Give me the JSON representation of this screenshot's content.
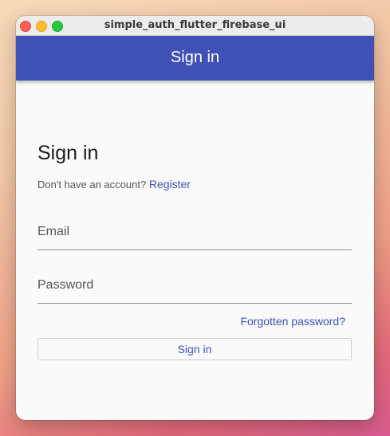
{
  "window": {
    "title": "simple_auth_flutter_firebase_ui"
  },
  "appbar": {
    "title": "Sign in"
  },
  "form": {
    "heading": "Sign in",
    "register_prompt": "Don't have an account?",
    "register_link": "Register",
    "email_placeholder": "Email",
    "email_value": "",
    "password_placeholder": "Password",
    "password_value": "",
    "forgot_password": "Forgotten password?",
    "submit_label": "Sign in"
  },
  "colors": {
    "primary": "#3f51b5",
    "background": "#fafafa"
  }
}
